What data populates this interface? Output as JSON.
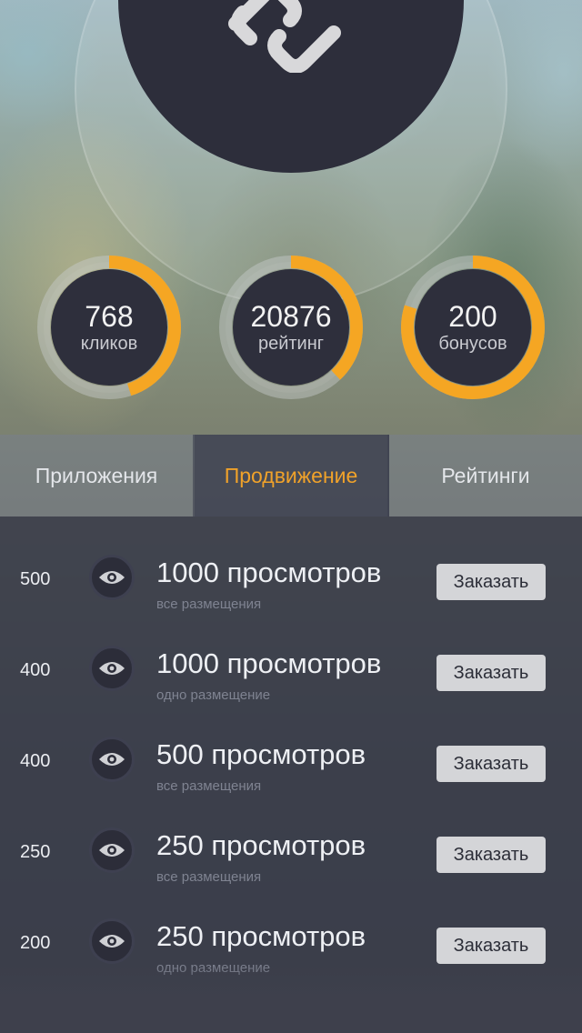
{
  "header": {
    "logo_icon": "chain-link-icon"
  },
  "stats": [
    {
      "value": "768",
      "label": "кликов",
      "progress": 0.45
    },
    {
      "value": "20876",
      "label": "рейтинг",
      "progress": 0.38
    },
    {
      "value": "200",
      "label": "бонусов",
      "progress": 0.8
    }
  ],
  "colors": {
    "accent": "#f5a623",
    "ring_track": "#6f7478",
    "dark": "#2e2f3c"
  },
  "tabs": [
    {
      "label": "Приложения",
      "active": false
    },
    {
      "label": "Продвижение",
      "active": true
    },
    {
      "label": "Рейтинги",
      "active": false
    }
  ],
  "offers": [
    {
      "price": "500",
      "title": "1000 просмотров",
      "subtitle": "все размещения",
      "button": "Заказать",
      "icon": "eye-icon"
    },
    {
      "price": "400",
      "title": "1000 просмотров",
      "subtitle": "одно размещение",
      "button": "Заказать",
      "icon": "eye-icon"
    },
    {
      "price": "400",
      "title": "500 просмотров",
      "subtitle": "все размещения",
      "button": "Заказать",
      "icon": "eye-icon"
    },
    {
      "price": "250",
      "title": "250 просмотров",
      "subtitle": "все размещения",
      "button": "Заказать",
      "icon": "eye-icon"
    },
    {
      "price": "200",
      "title": "250 просмотров",
      "subtitle": "одно размещение",
      "button": "Заказать",
      "icon": "eye-icon"
    }
  ]
}
